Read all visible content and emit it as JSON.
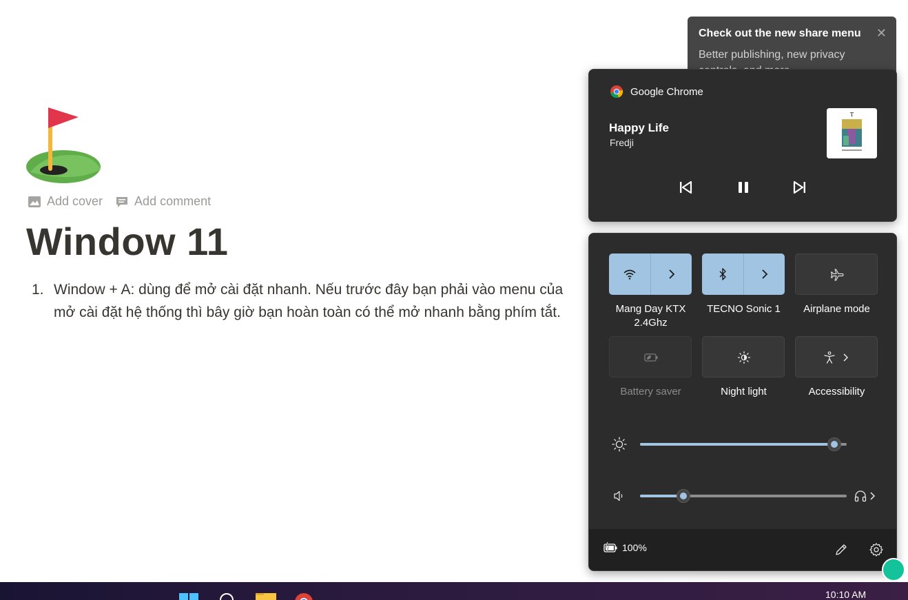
{
  "page": {
    "add_cover": "Add cover",
    "add_comment": "Add comment",
    "title": "Window 11",
    "list_number": "1.",
    "list_line1": "Window + A: dùng để mở cài đặt nhanh. Nếu trước đây bạn phải vào menu của",
    "list_line2": "mở cài đặt hệ thống thì bây giờ bạn hoàn toàn có thể mở nhanh bằng phím tắt."
  },
  "share_tip": {
    "title": "Check out the new share menu",
    "body": "Better publishing, new privacy controls, and more"
  },
  "media": {
    "app_name": "Google Chrome",
    "song": "Happy Life",
    "artist": "Fredji"
  },
  "quick_settings": {
    "tiles": [
      {
        "label": "Mang Day KTX 2.4Ghz",
        "icon": "wifi-icon",
        "active": true
      },
      {
        "label": "TECNO Sonic 1",
        "icon": "bluetooth-icon",
        "active": true
      },
      {
        "label": "Airplane mode",
        "icon": "airplane-icon",
        "active": false
      },
      {
        "label": "Battery saver",
        "icon": "battery-saver-icon",
        "active": false,
        "disabled": true
      },
      {
        "label": "Night light",
        "icon": "night-light-icon",
        "active": false
      },
      {
        "label": "Accessibility",
        "icon": "accessibility-icon",
        "active": false
      }
    ],
    "brightness": 0.94,
    "volume": 0.21,
    "battery": "100%"
  },
  "taskbar": {
    "clock": "10:10 AM"
  },
  "colors": {
    "accent": "#a0c4e2",
    "flyout_bg": "#2c2c2c",
    "footer_bg": "#202020"
  }
}
